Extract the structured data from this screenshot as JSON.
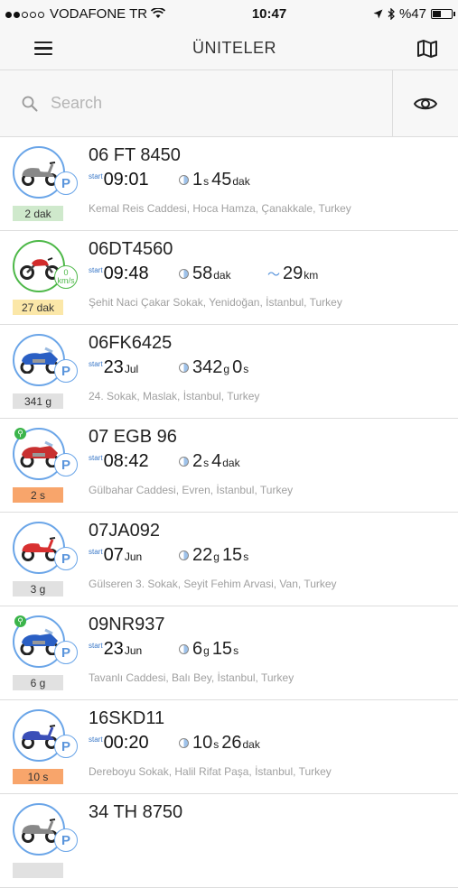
{
  "status": {
    "carrier": "VODAFONE TR",
    "time": "10:47",
    "battery": "%47",
    "battery_level": 0.47
  },
  "nav": {
    "title": "ÜNITELER"
  },
  "search": {
    "placeholder": "Search"
  },
  "colors": {
    "accent": "#5a95dc",
    "green": "#4db848",
    "divider": "#dddddd"
  },
  "units": [
    {
      "plate": "06 FT 8450",
      "start_label": "start",
      "start": "09:01",
      "start_unit": "",
      "d1": "1",
      "u1": "s",
      "d2": "45",
      "u2": "dak",
      "dist": "",
      "dist_unit": "",
      "address": "Kemal Reis Caddesi, Hoca Hamza, Çanakkale, Turkey",
      "tag": "2 dak",
      "vehicle": "scooter",
      "color": "#888888"
    },
    {
      "plate": "06DT4560",
      "start_label": "start",
      "start": "09:48",
      "start_unit": "",
      "d1": "58",
      "u1": "dak",
      "d2": "",
      "u2": "",
      "dist": "29",
      "dist_unit": "km",
      "address": "Şehit Naci Çakar Sokak, Yenidoğan, İstanbul, Turkey",
      "tag": "27 dak",
      "vehicle": "motorcycle",
      "color": "#d22b2b",
      "speed": "0",
      "speed_unit": "km/s"
    },
    {
      "plate": "06FK6425",
      "start_label": "start",
      "start": "23",
      "start_unit": "Jul",
      "d1": "342",
      "u1": "g",
      "d2": "0",
      "u2": "s",
      "dist": "",
      "dist_unit": "",
      "address": "24. Sokak, Maslak, İstanbul, Turkey",
      "tag": "341 g",
      "vehicle": "touring",
      "color": "#2a5fc4"
    },
    {
      "plate": "07 EGB 96",
      "start_label": "start",
      "start": "08:42",
      "start_unit": "",
      "d1": "2",
      "u1": "s",
      "d2": "4",
      "u2": "dak",
      "dist": "",
      "dist_unit": "",
      "address": "Gülbahar Caddesi, Evren, İstanbul, Turkey",
      "tag": "2 s",
      "vehicle": "touring",
      "color": "#c83030"
    },
    {
      "plate": "07JA092",
      "start_label": "start",
      "start": "07",
      "start_unit": "Jun",
      "d1": "22",
      "u1": "g",
      "d2": "15",
      "u2": "s",
      "dist": "",
      "dist_unit": "",
      "address": "Gülseren 3. Sokak, Seyit Fehim Arvasi, Van, Turkey",
      "tag": "3 g",
      "vehicle": "scooter",
      "color": "#d83030"
    },
    {
      "plate": "09NR937",
      "start_label": "start",
      "start": "23",
      "start_unit": "Jun",
      "d1": "6",
      "u1": "g",
      "d2": "15",
      "u2": "s",
      "dist": "",
      "dist_unit": "",
      "address": "Tavanlı Caddesi, Balı Bey, İstanbul, Turkey",
      "tag": "6 g",
      "vehicle": "touring",
      "color": "#2a5fc4"
    },
    {
      "plate": "16SKD11",
      "start_label": "start",
      "start": "00:20",
      "start_unit": "",
      "d1": "10",
      "u1": "s",
      "d2": "26",
      "u2": "dak",
      "dist": "",
      "dist_unit": "",
      "address": "Dereboyu Sokak, Halil Rifat Paşa, İstanbul, Turkey",
      "tag": "10 s",
      "vehicle": "scooter",
      "color": "#3b4fb8"
    },
    {
      "plate": "34 TH 8750",
      "start_label": "",
      "start": "",
      "start_unit": "",
      "d1": "",
      "u1": "",
      "d2": "",
      "u2": "",
      "dist": "",
      "dist_unit": "",
      "address": "",
      "tag": "",
      "vehicle": "scooter",
      "color": "#888888"
    }
  ]
}
